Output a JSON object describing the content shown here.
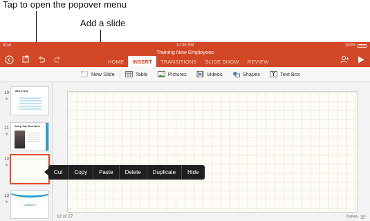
{
  "callouts": {
    "popover": "Tap to open the popover menu",
    "add_slide": "Add a slide"
  },
  "status": {
    "carrier": "iPad",
    "time": "12:06 PM",
    "battery": "100%"
  },
  "document": {
    "title": "Training New Employees"
  },
  "toolbar_icons": [
    "back-icon",
    "file-icon",
    "undo-icon",
    "redo-icon",
    "share-user-icon",
    "play-icon"
  ],
  "tabs": [
    {
      "label": "HOME",
      "active": false
    },
    {
      "label": "INSERT",
      "active": true
    },
    {
      "label": "TRANSITIONS",
      "active": false
    },
    {
      "label": "SLIDE SHOW",
      "active": false
    },
    {
      "label": "REVIEW",
      "active": false
    }
  ],
  "ribbon": {
    "new_slide": "New Slide",
    "table": "Table",
    "pictures": "Pictures",
    "videos": "Videos",
    "shapes": "Shapes",
    "text_box": "Text Box"
  },
  "thumbnails": [
    {
      "number": "10",
      "title": "Who's Who"
    },
    {
      "number": "11",
      "title": "Doing Your Best Work"
    },
    {
      "number": "12",
      "title": ""
    },
    {
      "number": "13",
      "title": "Questions?"
    }
  ],
  "popover_menu": [
    "Cut",
    "Copy",
    "Paste",
    "Delete",
    "Duplicate",
    "Hide"
  ],
  "footer": {
    "slide_count": "12 of 17",
    "notes": "Notes"
  },
  "colors": {
    "accent": "#d24726",
    "selection": "#e14b2c",
    "popover": "#1f1f1f"
  }
}
